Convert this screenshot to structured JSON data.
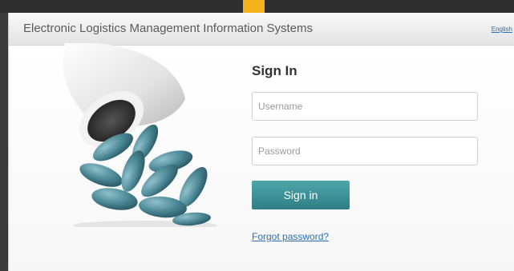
{
  "header": {
    "title": "Electronic Logistics Management Information Systems",
    "language_link": "English"
  },
  "form": {
    "heading": "Sign In",
    "username_placeholder": "Username",
    "username_value": "",
    "password_placeholder": "Password",
    "password_value": "",
    "submit_label": "Sign in",
    "forgot_label": "Forgot password?"
  },
  "colors": {
    "accent": "#3a9096",
    "link": "#2a6fb0",
    "top_tab": "#f6b21b"
  },
  "illustration": {
    "name": "pill-bottle-with-capsules"
  }
}
